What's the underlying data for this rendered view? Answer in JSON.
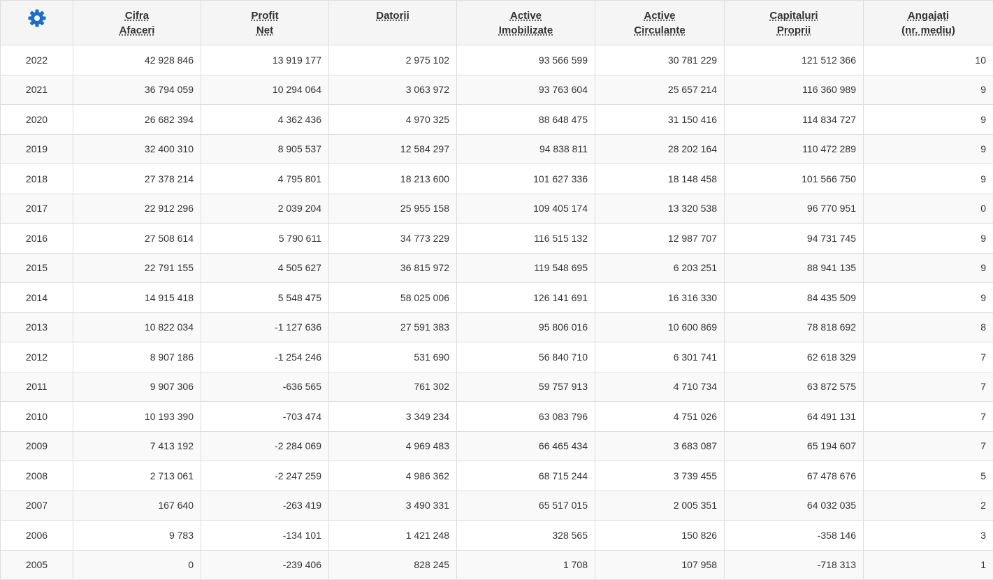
{
  "settings": {
    "icon": "gear-icon",
    "color": "#1a6fc4"
  },
  "headers": [
    {
      "line1": "Cifra",
      "line2": "Afaceri"
    },
    {
      "line1": "Profit",
      "line2": "Net"
    },
    {
      "line1": "Datorii",
      "line2": ""
    },
    {
      "line1": "Active",
      "line2": "Imobilizate"
    },
    {
      "line1": "Active",
      "line2": "Circulante"
    },
    {
      "line1": "Capitaluri",
      "line2": "Proprii"
    },
    {
      "line1": "Angajați",
      "line2": "(nr. mediu)"
    }
  ],
  "rows": [
    [
      "2022",
      "42 928 846",
      "13 919 177",
      "2 975 102",
      "93 566 599",
      "30 781 229",
      "121 512 366",
      "10"
    ],
    [
      "2021",
      "36 794 059",
      "10 294 064",
      "3 063 972",
      "93 763 604",
      "25 657 214",
      "116 360 989",
      "9"
    ],
    [
      "2020",
      "26 682 394",
      "4 362 436",
      "4 970 325",
      "88 648 475",
      "31 150 416",
      "114 834 727",
      "9"
    ],
    [
      "2019",
      "32 400 310",
      "8 905 537",
      "12 584 297",
      "94 838 811",
      "28 202 164",
      "110 472 289",
      "9"
    ],
    [
      "2018",
      "27 378 214",
      "4 795 801",
      "18 213 600",
      "101 627 336",
      "18 148 458",
      "101 566 750",
      "9"
    ],
    [
      "2017",
      "22 912 296",
      "2 039 204",
      "25 955 158",
      "109 405 174",
      "13 320 538",
      "96 770 951",
      "0"
    ],
    [
      "2016",
      "27 508 614",
      "5 790 611",
      "34 773 229",
      "116 515 132",
      "12 987 707",
      "94 731 745",
      "9"
    ],
    [
      "2015",
      "22 791 155",
      "4 505 627",
      "36 815 972",
      "119 548 695",
      "6 203 251",
      "88 941 135",
      "9"
    ],
    [
      "2014",
      "14 915 418",
      "5 548 475",
      "58 025 006",
      "126 141 691",
      "16 316 330",
      "84 435 509",
      "9"
    ],
    [
      "2013",
      "10 822 034",
      "-1 127 636",
      "27 591 383",
      "95 806 016",
      "10 600 869",
      "78 818 692",
      "8"
    ],
    [
      "2012",
      "8 907 186",
      "-1 254 246",
      "531 690",
      "56 840 710",
      "6 301 741",
      "62 618 329",
      "7"
    ],
    [
      "2011",
      "9 907 306",
      "-636 565",
      "761 302",
      "59 757 913",
      "4 710 734",
      "63 872 575",
      "7"
    ],
    [
      "2010",
      "10 193 390",
      "-703 474",
      "3 349 234",
      "63 083 796",
      "4 751 026",
      "64 491 131",
      "7"
    ],
    [
      "2009",
      "7 413 192",
      "-2 284 069",
      "4 969 483",
      "66 465 434",
      "3 683 087",
      "65 194 607",
      "7"
    ],
    [
      "2008",
      "2 713 061",
      "-2 247 259",
      "4 986 362",
      "68 715 244",
      "3 739 455",
      "67 478 676",
      "5"
    ],
    [
      "2007",
      "167 640",
      "-263 419",
      "3 490 331",
      "65 517 015",
      "2 005 351",
      "64 032 035",
      "2"
    ],
    [
      "2006",
      "9 783",
      "-134 101",
      "1 421 248",
      "328 565",
      "150 826",
      "-358 146",
      "3"
    ],
    [
      "2005",
      "0",
      "-239 406",
      "828 245",
      "1 708",
      "107 958",
      "-718 313",
      "1"
    ]
  ]
}
